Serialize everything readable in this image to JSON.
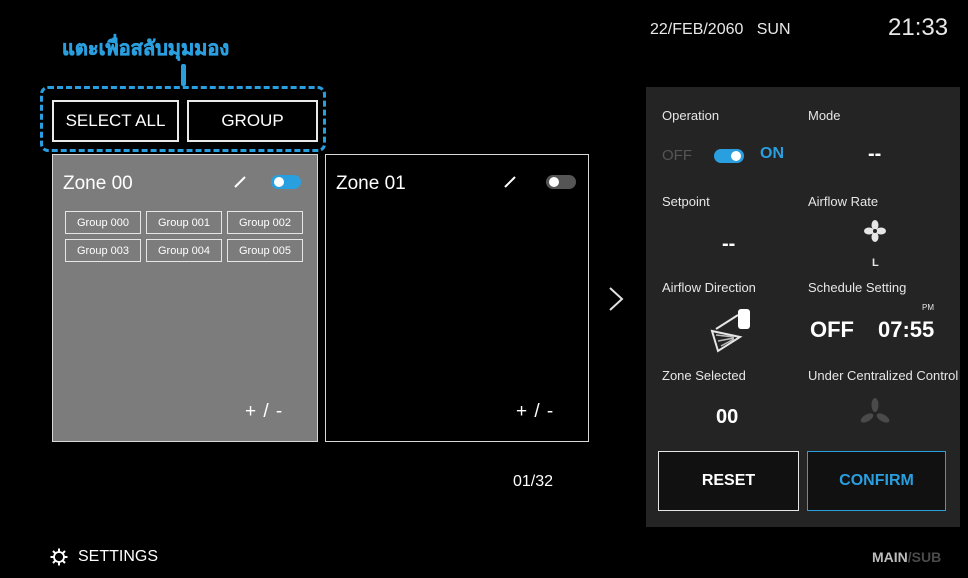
{
  "annotation": {
    "text": "แตะเพื่อสลับมุมมอง"
  },
  "header_buttons": {
    "select_all": "SELECT ALL",
    "group": "GROUP"
  },
  "zones": [
    {
      "name": "Zone 00",
      "power_on": true,
      "groups": [
        "Group 000",
        "Group 001",
        "Group 002",
        "Group 003",
        "Group 004",
        "Group 005"
      ],
      "add_remove_label": "+ / -"
    },
    {
      "name": "Zone 01",
      "power_on": false,
      "groups": [],
      "add_remove_label": "+ / -"
    }
  ],
  "pager": "01/32",
  "status_bar": {
    "date": "22/FEB/2060",
    "day": "SUN",
    "time": "21:33"
  },
  "panel": {
    "operation": {
      "label": "Operation",
      "off": "OFF",
      "on": "ON"
    },
    "mode": {
      "label": "Mode",
      "value": "--"
    },
    "setpoint": {
      "label": "Setpoint",
      "value": "--"
    },
    "airflow_rate": {
      "label": "Airflow Rate",
      "value": "L"
    },
    "airflow_direction": {
      "label": "Airflow Direction"
    },
    "schedule": {
      "label": "Schedule Setting",
      "ampm": "PM",
      "state": "OFF",
      "time": "07:55"
    },
    "zone_selected": {
      "label": "Zone Selected",
      "value": "00"
    },
    "centralized": {
      "label": "Under Centralized Control"
    },
    "reset": "RESET",
    "confirm": "CONFIRM"
  },
  "footer": {
    "settings": "SETTINGS",
    "main": "MAIN",
    "sep": "/",
    "sub": "SUB"
  },
  "colors": {
    "accent": "#2a9fe0",
    "zone_selected_bg": "#7c7c7c",
    "panel_bg": "#242424"
  }
}
